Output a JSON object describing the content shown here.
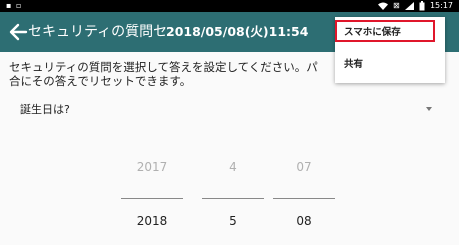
{
  "status_bar": {
    "time": "15:17",
    "icons": [
      "notification-icon",
      "screenshot-icon",
      "wifi-icon",
      "battery-icon"
    ]
  },
  "app_bar": {
    "title": "セキュリティの質問セ",
    "timestamp": "2018/05/08(火)11:54"
  },
  "description": {
    "line1": "セキュリティの質問を選択して答えを設定してください。パ",
    "line2": "合にその答えでリセットできます。"
  },
  "question_dropdown": {
    "selected": "誕生日は?"
  },
  "date_picker": {
    "year": {
      "previous": "2017",
      "current": "2018"
    },
    "month": {
      "previous": "4",
      "current": "5"
    },
    "day": {
      "previous": "07",
      "current": "08"
    }
  },
  "overflow_menu": {
    "items": [
      {
        "label": "スマホに保存",
        "highlighted": true
      },
      {
        "label": "共有",
        "highlighted": false
      }
    ]
  },
  "colors": {
    "app_bar": "#2d6e73",
    "highlight": "#e0162b"
  }
}
